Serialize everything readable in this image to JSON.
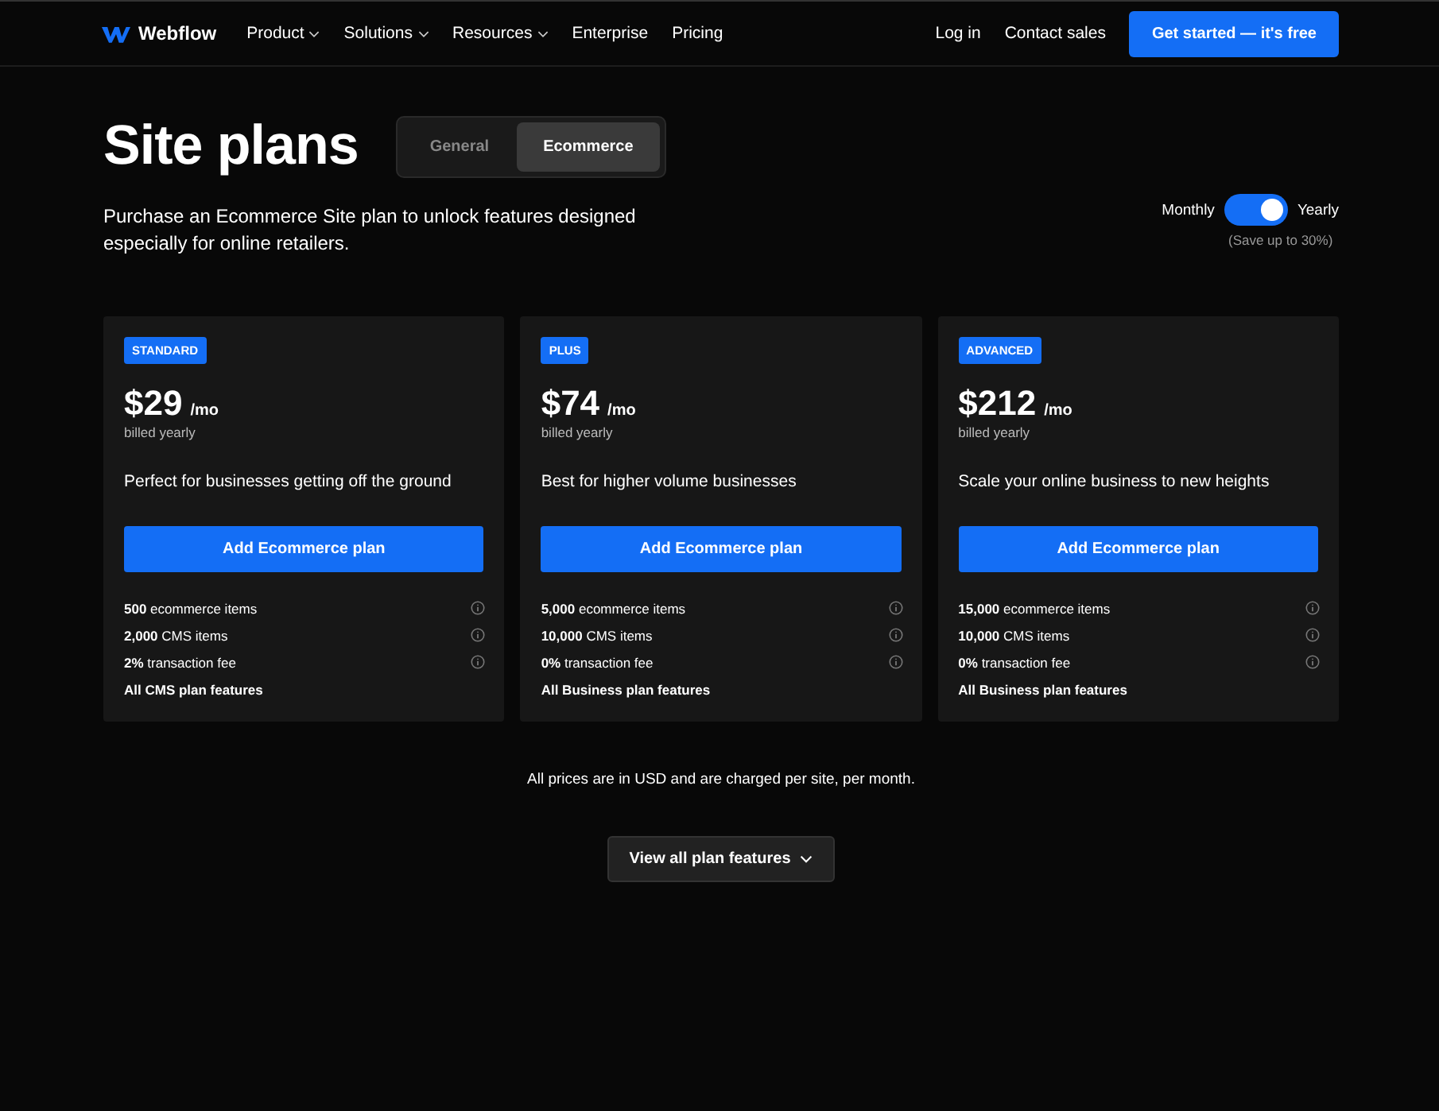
{
  "nav": {
    "brand": "Webflow",
    "menu": [
      {
        "label": "Product",
        "dropdown": true
      },
      {
        "label": "Solutions",
        "dropdown": true
      },
      {
        "label": "Resources",
        "dropdown": true
      },
      {
        "label": "Enterprise",
        "dropdown": false
      },
      {
        "label": "Pricing",
        "dropdown": false
      }
    ],
    "right": [
      "Log in",
      "Contact sales"
    ],
    "cta": "Get started — it's free"
  },
  "title": "Site plans",
  "tabs": [
    {
      "label": "General",
      "selected": false
    },
    {
      "label": "Ecommerce",
      "selected": true
    }
  ],
  "intro": "Purchase an Ecommerce Site plan to unlock features designed especially for online retailers.",
  "billing": {
    "left": "Monthly",
    "right": "Yearly",
    "on": true,
    "note": "(Save up to 30%)"
  },
  "plans": [
    {
      "badge": "STANDARD",
      "price": "$29",
      "unit": "/mo",
      "billing": "billed yearly",
      "tagline": "Perfect for businesses getting off the ground",
      "button": "Add Ecommerce plan",
      "features": [
        {
          "text": "**500** ecommerce items",
          "info": true
        },
        {
          "text": "**2,000** CMS items",
          "info": true
        },
        {
          "text": "**2%** transaction fee",
          "info": true
        },
        {
          "text": "**All CMS plan features**",
          "info": false
        }
      ]
    },
    {
      "badge": "PLUS",
      "price": "$74",
      "unit": "/mo",
      "billing": "billed yearly",
      "tagline": "Best for higher volume businesses",
      "button": "Add Ecommerce plan",
      "features": [
        {
          "text": "**5,000** ecommerce items",
          "info": true
        },
        {
          "text": "**10,000** CMS items",
          "info": true
        },
        {
          "text": "**0%** transaction fee",
          "info": true
        },
        {
          "text": "**All Business plan features**",
          "info": false
        }
      ]
    },
    {
      "badge": "ADVANCED",
      "price": "$212",
      "unit": "/mo",
      "billing": "billed yearly",
      "tagline": "Scale your online business to new heights",
      "button": "Add Ecommerce plan",
      "features": [
        {
          "text": "**15,000** ecommerce items",
          "info": true
        },
        {
          "text": "**10,000** CMS items",
          "info": true
        },
        {
          "text": "**0%** transaction fee",
          "info": true
        },
        {
          "text": "**All Business plan features**",
          "info": false
        }
      ]
    }
  ],
  "footnote": "All prices are in USD and are charged per site, per month.",
  "more": "View all plan features"
}
